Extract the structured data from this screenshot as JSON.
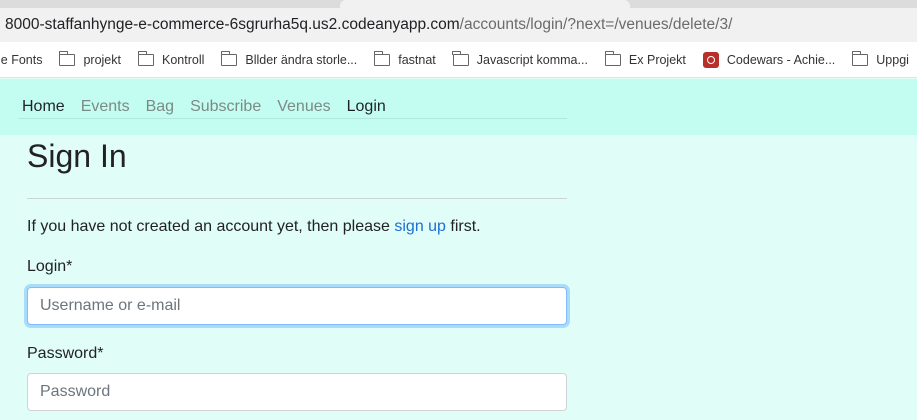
{
  "browser": {
    "url_host": "8000-staffanhynge-e-commerce-6sgrurha5q.us2.codeanyapp.com",
    "url_path": "/accounts/login/?next=/venues/delete/3/"
  },
  "bookmarks": [
    {
      "label": "le Fonts",
      "icon": "none"
    },
    {
      "label": "projekt",
      "icon": "folder-icon"
    },
    {
      "label": "Kontroll",
      "icon": "folder-icon"
    },
    {
      "label": "Bllder ändra storle...",
      "icon": "folder-icon"
    },
    {
      "label": "fastnat",
      "icon": "folder-icon"
    },
    {
      "label": "Javascript komma...",
      "icon": "folder-icon"
    },
    {
      "label": "Ex Projekt",
      "icon": "folder-icon"
    },
    {
      "label": "Codewars - Achie...",
      "icon": "codewars-icon"
    },
    {
      "label": "Uppgi",
      "icon": "folder-icon"
    }
  ],
  "nav": {
    "home": "Home",
    "events": "Events",
    "bag": "Bag",
    "subscribe": "Subscribe",
    "venues": "Venues",
    "login": "Login"
  },
  "page": {
    "title": "Sign In",
    "intro_prefix": "If you have not created an account yet, then please ",
    "intro_link": "sign up",
    "intro_suffix": " first."
  },
  "form": {
    "login_label": "Login*",
    "login_placeholder": "Username or e-mail",
    "login_value": "",
    "password_label": "Password*",
    "password_placeholder": "Password",
    "password_value": ""
  },
  "colors": {
    "navbar_bg": "#c3fdf1",
    "page_bg": "#e0fdf8",
    "link": "#1c6fd4"
  }
}
